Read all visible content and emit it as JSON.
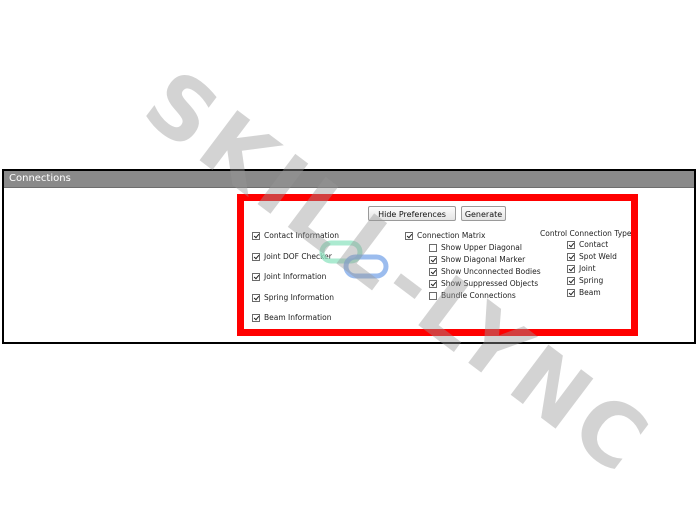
{
  "panel": {
    "title": "Connections"
  },
  "buttons": {
    "hide_preferences": "Hide Preferences",
    "generate": "Generate"
  },
  "left_options": [
    {
      "label": "Contact Information",
      "checked": true
    },
    {
      "label": "Joint DOF Checker",
      "checked": true
    },
    {
      "label": "Joint Information",
      "checked": true
    },
    {
      "label": "Spring Information",
      "checked": true
    },
    {
      "label": "Beam Information",
      "checked": true
    }
  ],
  "connection_matrix": {
    "label": "Connection Matrix",
    "checked": true,
    "sub_options": [
      {
        "label": "Show Upper Diagonal",
        "checked": false
      },
      {
        "label": "Show Diagonal Marker",
        "checked": true
      },
      {
        "label": "Show Unconnected Bodies",
        "checked": true
      },
      {
        "label": "Show Suppressed Objects",
        "checked": true
      },
      {
        "label": "Bundle Connections",
        "checked": false
      }
    ]
  },
  "control_types": {
    "label": "Control Connection Types",
    "items": [
      {
        "label": "Contact",
        "checked": true
      },
      {
        "label": "Spot Weld",
        "checked": true
      },
      {
        "label": "Joint",
        "checked": true
      },
      {
        "label": "Spring",
        "checked": true
      },
      {
        "label": "Beam",
        "checked": true
      }
    ]
  },
  "watermark": {
    "text": "SKILL-LYNC"
  },
  "colors": {
    "highlight": "#ff0000",
    "header_bg": "#8a8a8a",
    "logo_green": "#8fe3c0",
    "logo_blue": "#7aa6e8"
  }
}
